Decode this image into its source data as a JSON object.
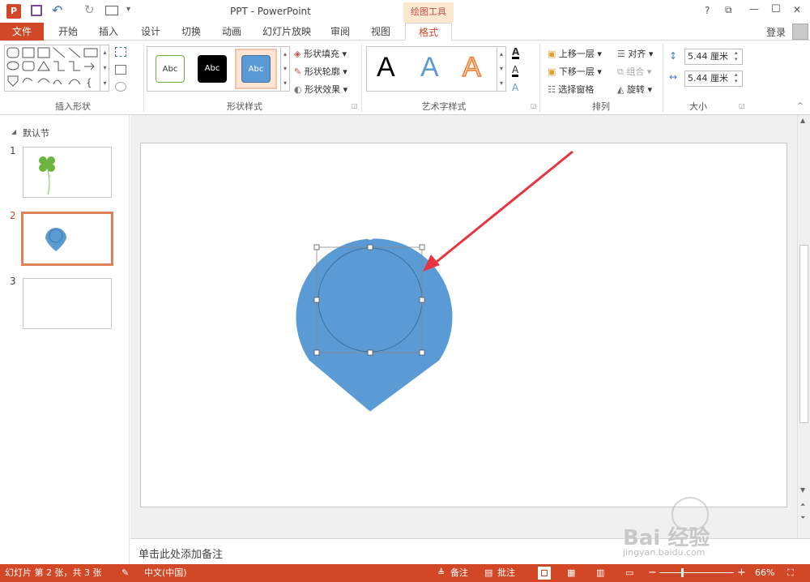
{
  "window": {
    "title": "PPT - PowerPoint",
    "context_tab": "绘图工具"
  },
  "quick_access": {
    "undo": "↶",
    "redo": "↻"
  },
  "window_controls": {
    "help": "?",
    "restore": "⧉",
    "minimize": "—",
    "maximize": "☐",
    "close": "✕"
  },
  "tabs": [
    "文件",
    "开始",
    "插入",
    "设计",
    "切换",
    "动画",
    "幻灯片放映",
    "审阅",
    "视图",
    "格式"
  ],
  "login": "登录",
  "ribbon": {
    "groups": {
      "insert_shapes": "插入形状",
      "shape_styles": "形状样式",
      "wordart_styles": "艺术字样式",
      "arrange": "排列",
      "size": "大小"
    },
    "style_samples": [
      "Abc",
      "Abc",
      "Abc"
    ],
    "shape_fill": "形状填充",
    "shape_outline": "形状轮廓",
    "shape_effects": "形状效果",
    "wordart_letter": "A",
    "bring_forward": "上移一层",
    "send_backward": "下移一层",
    "selection_pane": "选择窗格",
    "align": "对齐",
    "group": "组合",
    "rotate": "旋转",
    "height": "5.44 厘米",
    "width": "5.44 厘米"
  },
  "slides_pane": {
    "section": "默认节",
    "numbers": [
      "1",
      "2",
      "3"
    ]
  },
  "notes_placeholder": "单击此处添加备注",
  "status": {
    "slide_info": "幻灯片 第 2 张，共 3 张",
    "language": "中文(中国)",
    "notes": "备注",
    "comments": "批注",
    "zoom_minus": "−",
    "zoom_plus": "+",
    "zoom": "66%"
  },
  "watermark": {
    "brand": "Bai  经验",
    "url": "jingyan.baidu.com"
  },
  "colors": {
    "accent": "#d24726",
    "shape_fill": "#5b9bd5",
    "arrow": "#e8343f"
  }
}
